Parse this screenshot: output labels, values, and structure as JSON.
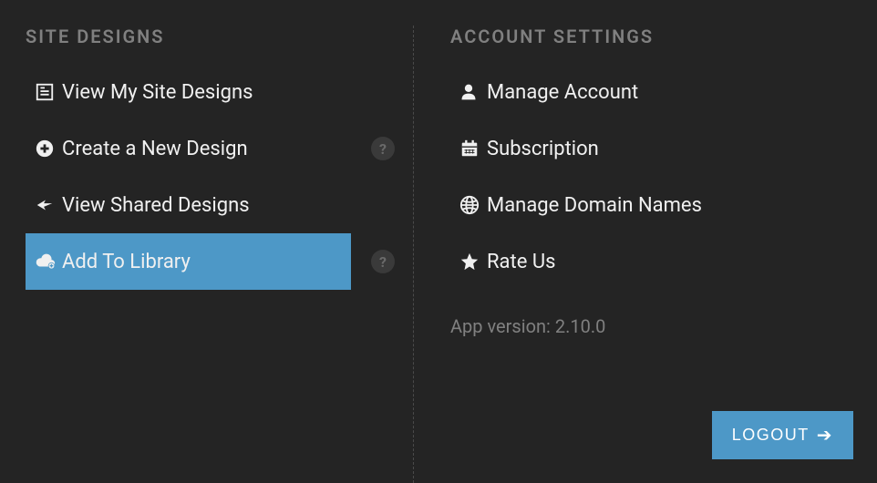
{
  "site_designs": {
    "title": "Site Designs",
    "items": [
      {
        "label": "View My Site Designs",
        "icon": "document-icon"
      },
      {
        "label": "Create a New Design",
        "icon": "plus-circle-icon"
      },
      {
        "label": "View Shared Designs",
        "icon": "share-icon"
      },
      {
        "label": "Add To Library",
        "icon": "cloud-add-icon"
      }
    ]
  },
  "account_settings": {
    "title": "Account Settings",
    "items": [
      {
        "label": "Manage Account",
        "icon": "person-icon"
      },
      {
        "label": "Subscription",
        "icon": "calendar-icon"
      },
      {
        "label": "Manage Domain Names",
        "icon": "globe-icon"
      },
      {
        "label": "Rate Us",
        "icon": "star-icon"
      }
    ],
    "app_version_text": "App version: 2.10.0"
  },
  "logout": {
    "label": "Logout"
  }
}
